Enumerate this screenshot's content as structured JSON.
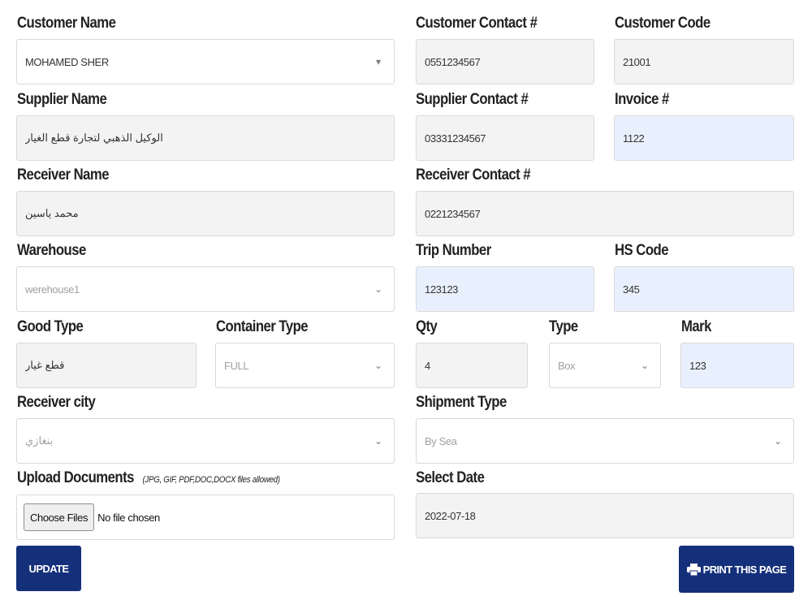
{
  "customer_name": {
    "label": "Customer Name",
    "value": "MOHAMED SHER"
  },
  "customer_contact": {
    "label": "Customer Contact #",
    "value": "0551234567"
  },
  "customer_code": {
    "label": "Customer Code",
    "value": "21001"
  },
  "supplier_name": {
    "label": "Supplier Name",
    "value": "الوكيل الذهبي لتجارة قطع الغيار"
  },
  "supplier_contact": {
    "label": "Supplier Contact #",
    "value": "03331234567"
  },
  "invoice": {
    "label": "Invoice #",
    "value": "1122"
  },
  "receiver_name": {
    "label": "Receiver Name",
    "value": "محمد ياسين"
  },
  "receiver_contact": {
    "label": "Receiver Contact #",
    "value": "0221234567"
  },
  "warehouse": {
    "label": "Warehouse",
    "value": "werehouse1"
  },
  "trip_number": {
    "label": "Trip Number",
    "value": "123123"
  },
  "hs_code": {
    "label": "HS Code",
    "value": "345"
  },
  "good_type": {
    "label": "Good Type",
    "value": "قطع غيار"
  },
  "container_type": {
    "label": "Container Type",
    "value": "FULL"
  },
  "qty": {
    "label": "Qty",
    "value": "4"
  },
  "type": {
    "label": "Type",
    "value": "Box"
  },
  "mark": {
    "label": "Mark",
    "value": "123"
  },
  "receiver_city": {
    "label": "Receiver city",
    "value": "بنغازي"
  },
  "shipment_type": {
    "label": "Shipment Type",
    "value": "By Sea"
  },
  "upload_documents": {
    "label": "Upload Documents",
    "hint": "(JPG, GIF, PDF,DOC,DOCX files allowed)",
    "button_label": "Choose Files",
    "status": "No file chosen"
  },
  "select_date": {
    "label": "Select Date",
    "value": "2022-07-18"
  },
  "buttons": {
    "update": "UPDATE",
    "print": "PRINT THIS PAGE"
  },
  "icons": {
    "dropdown": "chevron-down-icon",
    "print": "printer-icon"
  },
  "colors": {
    "primary_button": "#15307a",
    "highlight_field": "#e9f0fd",
    "readonly_field": "#f3f3f3"
  }
}
